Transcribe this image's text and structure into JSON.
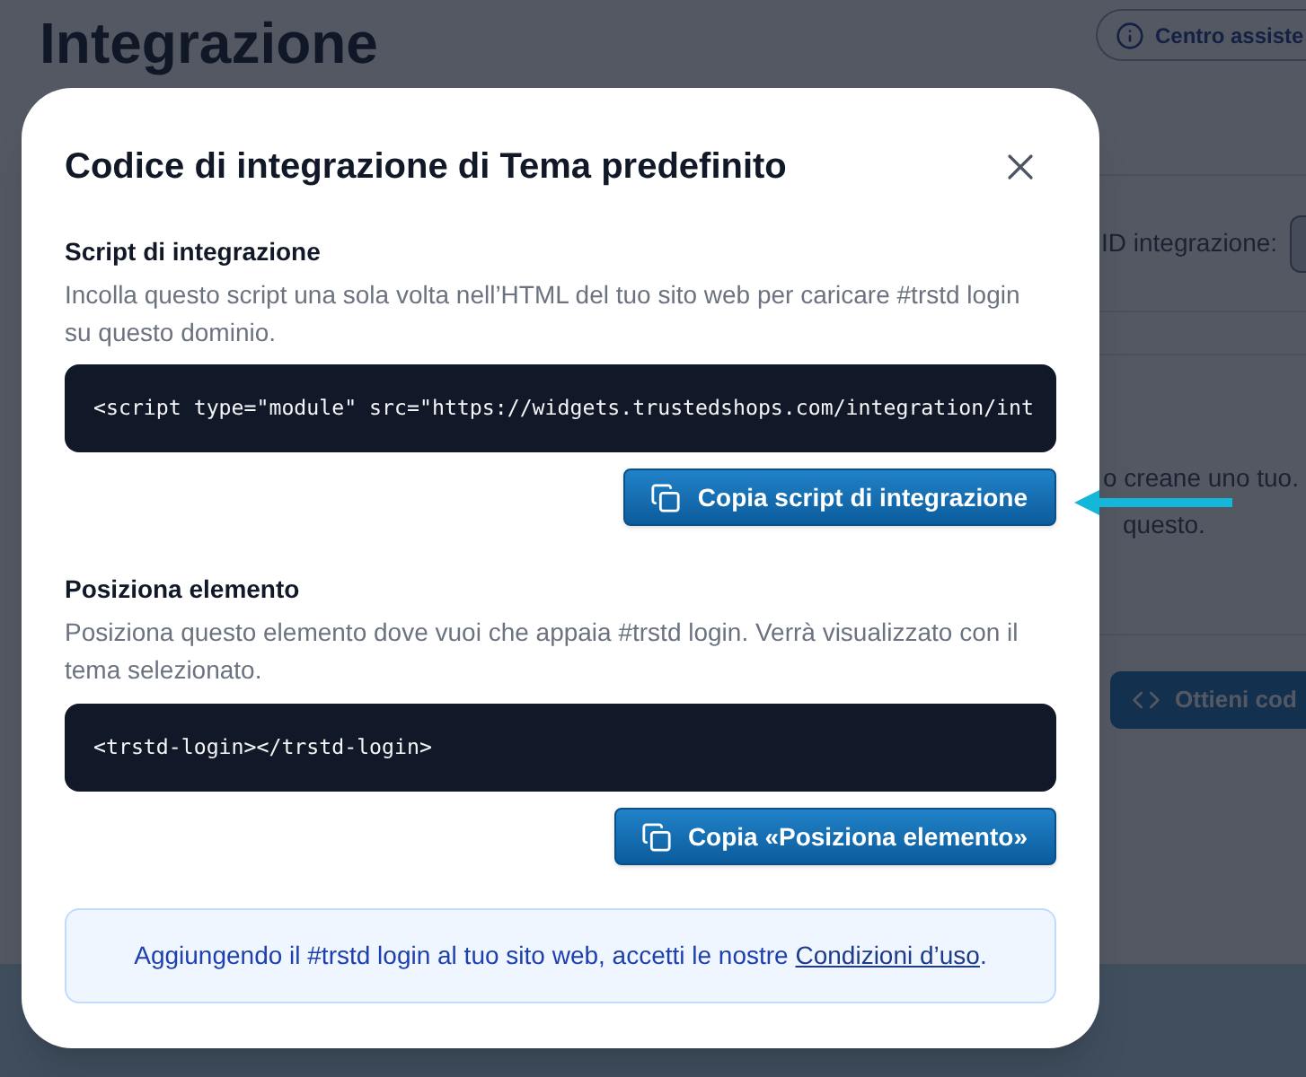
{
  "page": {
    "title": "Integrazione",
    "help_button": "Centro assiste",
    "integration_id_label": "ID integrazione:",
    "text_fragments": [
      "o creane uno tuo.",
      "questo."
    ],
    "get_code_button": "Ottieni cod"
  },
  "dialog": {
    "title": "Codice di integrazione di Tema predefinito",
    "sections": [
      {
        "heading": "Script di integrazione",
        "description": "Incolla questo script una sola volta nell’HTML del tuo sito web per caricare #trstd login su questo dominio.",
        "code": "<script type=\"module\" src=\"https://widgets.trustedshops.com/integration/int",
        "copy_button": "Copia script di integrazione"
      },
      {
        "heading": "Posiziona elemento",
        "description": "Posiziona questo elemento dove vuoi che appaia #trstd login. Verrà visualizzato con il tema selezionato.",
        "code": "<trstd-login></trstd-login>",
        "copy_button": "Copia «Posiziona elemento»"
      }
    ],
    "notice": {
      "text": "Aggiungendo il #trstd login al tuo sito web, accetti le nostre",
      "link": "Condizioni d’uso",
      "text_after": "."
    }
  }
}
